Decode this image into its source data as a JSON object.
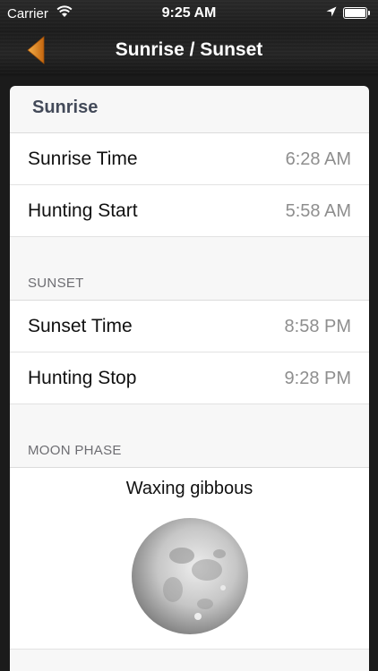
{
  "status_bar": {
    "carrier": "Carrier",
    "time": "9:25 AM"
  },
  "nav": {
    "title": "Sunrise / Sunset",
    "back_icon": "orange-triangle-back-icon"
  },
  "sunrise": {
    "title": "Sunrise",
    "rows": [
      {
        "label": "Sunrise Time",
        "value": "6:28 AM"
      },
      {
        "label": "Hunting Start",
        "value": "5:58 AM"
      }
    ]
  },
  "sunset": {
    "header": "SUNSET",
    "rows": [
      {
        "label": "Sunset Time",
        "value": "8:58 PM"
      },
      {
        "label": "Hunting Stop",
        "value": "9:28 PM"
      }
    ]
  },
  "moon": {
    "header": "MOON PHASE",
    "phase": "Waxing gibbous"
  },
  "colors": {
    "accent": "#e38a1c",
    "section_title": "#434a59",
    "value_gray": "#8e8e8e"
  }
}
